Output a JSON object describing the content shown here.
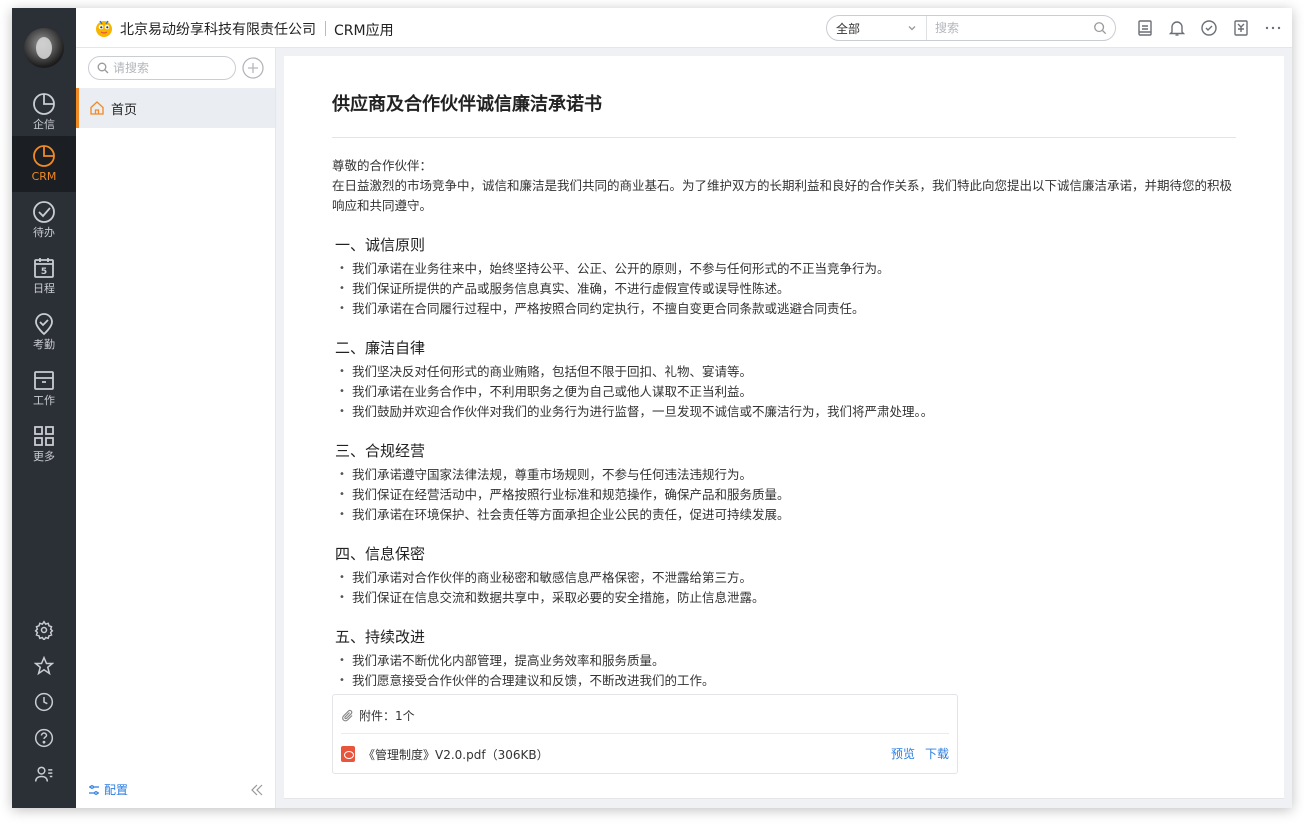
{
  "topbar": {
    "company": "北京易动纷享科技有限责任公司",
    "app_name": "CRM应用",
    "search_scope": "全部",
    "search_placeholder": "搜索"
  },
  "rail": {
    "items": [
      {
        "label": "企信",
        "icon": "clock-icon"
      },
      {
        "label": "CRM",
        "icon": "crm-icon",
        "active": true
      },
      {
        "label": "待办",
        "icon": "check-circle-icon"
      },
      {
        "label": "日程",
        "icon": "calendar-icon",
        "day": "5"
      },
      {
        "label": "考勤",
        "icon": "location-check-icon"
      },
      {
        "label": "工作",
        "icon": "briefcase-icon"
      },
      {
        "label": "更多",
        "icon": "grid-icon"
      }
    ],
    "tools": [
      "settings-icon",
      "star-icon",
      "history-icon",
      "help-icon",
      "user-list-icon"
    ]
  },
  "side": {
    "search_placeholder": "请搜索",
    "home_label": "首页",
    "config_label": "配置"
  },
  "doc": {
    "title": "供应商及合作伙伴诚信廉洁承诺书",
    "greeting": "尊敬的合作伙伴：",
    "intro": "在日益激烈的市场竞争中，诚信和廉洁是我们共同的商业基石。为了维护双方的长期利益和良好的合作关系，我们特此向您提出以下诚信廉洁承诺，并期待您的积极响应和共同遵守。",
    "sections": [
      {
        "title": "一、诚信原则",
        "bullets": [
          "我们承诺在业务往来中，始终坚持公平、公正、公开的原则，不参与任何形式的不正当竞争行为。",
          " 我们保证所提供的产品或服务信息真实、准确，不进行虚假宣传或误导性陈述。",
          "我们承诺在合同履行过程中，严格按照合同约定执行，不擅自变更合同条款或逃避合同责任。"
        ]
      },
      {
        "title": "二、廉洁自律",
        "bullets": [
          "我们坚决反对任何形式的商业贿赂，包括但不限于回扣、礼物、宴请等。",
          " 我们承诺在业务合作中，不利用职务之便为自己或他人谋取不正当利益。",
          "我们鼓励并欢迎合作伙伴对我们的业务行为进行监督，一旦发现不诚信或不廉洁行为，我们将严肃处理。。"
        ]
      },
      {
        "title": "三、合规经营",
        "bullets": [
          "我们承诺遵守国家法律法规，尊重市场规则，不参与任何违法违规行为。",
          "我们保证在经营活动中，严格按照行业标准和规范操作，确保产品和服务质量。",
          "我们承诺在环境保护、社会责任等方面承担企业公民的责任，促进可持续发展。"
        ]
      },
      {
        "title": "四、信息保密",
        "bullets": [
          "我们承诺对合作伙伴的商业秘密和敏感信息严格保密，不泄露给第三方。",
          "我们保证在信息交流和数据共享中，采取必要的安全措施，防止信息泄露。"
        ]
      },
      {
        "title": "五、持续改进",
        "bullets": [
          "我们承诺不断优化内部管理，提高业务效率和服务质量。",
          "我们愿意接受合作伙伴的合理建议和反馈，不断改进我们的工作。"
        ]
      }
    ],
    "attachment": {
      "header": "附件：1个",
      "file_name": "《管理制度》V2.0.pdf（306KB）",
      "preview_label": "预览",
      "download_label": "下载"
    }
  },
  "colors": {
    "accent": "#f08a24",
    "link": "#2a7de1",
    "rail_bg": "#2b2f36"
  }
}
